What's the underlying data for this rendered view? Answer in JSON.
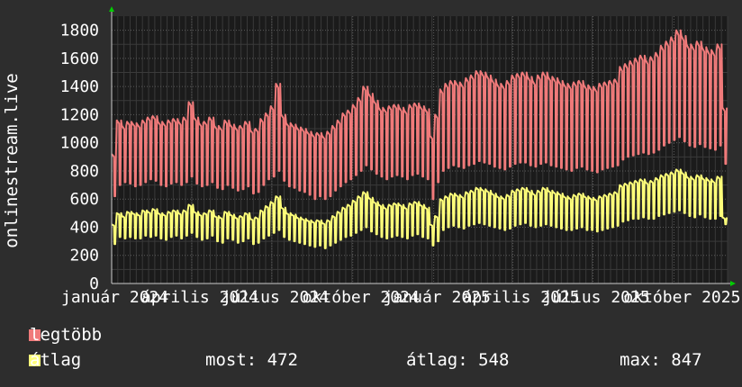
{
  "chart_data": {
    "type": "line",
    "ylabel": "onlinestream.live",
    "ylim": [
      0,
      1900
    ],
    "yticks": [
      0,
      200,
      400,
      600,
      800,
      1000,
      1200,
      1400,
      1600,
      1800
    ],
    "xlim": [
      0,
      700
    ],
    "xticks": [
      {
        "label": "január 2024",
        "x": 0
      },
      {
        "label": "április 2024",
        "x": 91
      },
      {
        "label": "július 2024",
        "x": 182
      },
      {
        "label": "október 2024",
        "x": 274
      },
      {
        "label": "január 2025",
        "x": 366
      },
      {
        "label": "április 2025",
        "x": 456
      },
      {
        "label": "július 2025",
        "x": 547
      },
      {
        "label": "október 2025",
        "x": 639
      }
    ],
    "grid": true,
    "series": [
      {
        "name": "legtöbb",
        "color": "#f07a7a",
        "values": [
          920,
          1160,
          1120,
          1150,
          1140,
          1130,
          1160,
          1180,
          1190,
          1150,
          1140,
          1160,
          1170,
          1150,
          1180,
          1290,
          1180,
          1140,
          1150,
          1180,
          1120,
          1110,
          1160,
          1130,
          1110,
          1120,
          1150,
          1090,
          1100,
          1170,
          1210,
          1260,
          1420,
          1200,
          1140,
          1130,
          1110,
          1100,
          1080,
          1060,
          1070,
          1050,
          1080,
          1120,
          1160,
          1210,
          1230,
          1270,
          1320,
          1400,
          1350,
          1300,
          1250,
          1240,
          1260,
          1270,
          1250,
          1230,
          1270,
          1280,
          1260,
          1240,
          1050,
          1200,
          1380,
          1420,
          1440,
          1430,
          1420,
          1460,
          1480,
          1510,
          1500,
          1480,
          1450,
          1420,
          1410,
          1440,
          1480,
          1490,
          1500,
          1470,
          1440,
          1480,
          1500,
          1470,
          1460,
          1440,
          1420,
          1410,
          1430,
          1440,
          1410,
          1400,
          1390,
          1420,
          1430,
          1440,
          1450,
          1540,
          1560,
          1580,
          1600,
          1620,
          1590,
          1610,
          1640,
          1690,
          1720,
          1750,
          1800,
          1760,
          1700,
          1690,
          1720,
          1680,
          1660,
          1650,
          1700,
          1250
        ],
        "dips": [
          620,
          700,
          720,
          710,
          690,
          700,
          720,
          740,
          730,
          700,
          690,
          710,
          720,
          700,
          720,
          760,
          710,
          690,
          700,
          720,
          680,
          670,
          700,
          680,
          660,
          670,
          690,
          640,
          650,
          700,
          740,
          760,
          800,
          730,
          690,
          680,
          660,
          650,
          630,
          600,
          620,
          600,
          620,
          660,
          690,
          720,
          740,
          770,
          800,
          840,
          810,
          780,
          760,
          740,
          760,
          770,
          760,
          740,
          770,
          780,
          760,
          740,
          600,
          720,
          800,
          820,
          840,
          830,
          820,
          840,
          850,
          870,
          860,
          850,
          830,
          820,
          810,
          830,
          850,
          860,
          860,
          840,
          830,
          850,
          860,
          840,
          830,
          820,
          810,
          800,
          820,
          830,
          810,
          800,
          790,
          810,
          820,
          830,
          840,
          880,
          900,
          910,
          920,
          930,
          920,
          930,
          950,
          980,
          1000,
          1020,
          1040,
          1010,
          980,
          970,
          990,
          970,
          960,
          950,
          980,
          850
        ]
      },
      {
        "name": "átlag",
        "color": "#ffff7a",
        "values": [
          420,
          500,
          480,
          510,
          500,
          490,
          520,
          510,
          530,
          500,
          490,
          510,
          520,
          500,
          520,
          560,
          510,
          490,
          500,
          520,
          480,
          470,
          510,
          490,
          470,
          480,
          500,
          460,
          470,
          520,
          550,
          580,
          620,
          540,
          500,
          490,
          470,
          460,
          450,
          440,
          450,
          430,
          450,
          480,
          510,
          540,
          560,
          590,
          620,
          650,
          610,
          580,
          560,
          540,
          560,
          570,
          560,
          540,
          570,
          580,
          560,
          540,
          420,
          480,
          600,
          620,
          640,
          630,
          620,
          650,
          660,
          680,
          670,
          660,
          640,
          620,
          610,
          630,
          660,
          670,
          680,
          660,
          640,
          660,
          680,
          660,
          650,
          640,
          620,
          610,
          630,
          640,
          620,
          610,
          600,
          620,
          630,
          640,
          650,
          700,
          710,
          720,
          730,
          740,
          720,
          730,
          750,
          770,
          780,
          790,
          810,
          790,
          760,
          750,
          770,
          750,
          740,
          730,
          760,
          470
        ],
        "dips": [
          280,
          330,
          320,
          330,
          320,
          320,
          340,
          330,
          340,
          320,
          310,
          330,
          340,
          320,
          340,
          360,
          330,
          310,
          320,
          340,
          300,
          290,
          320,
          310,
          290,
          300,
          320,
          280,
          290,
          320,
          340,
          360,
          380,
          330,
          310,
          300,
          290,
          280,
          270,
          260,
          270,
          250,
          270,
          290,
          310,
          330,
          340,
          360,
          380,
          400,
          370,
          350,
          330,
          320,
          330,
          340,
          330,
          320,
          340,
          350,
          330,
          320,
          270,
          300,
          380,
          400,
          410,
          400,
          390,
          410,
          420,
          430,
          420,
          410,
          400,
          390,
          380,
          390,
          410,
          420,
          430,
          410,
          400,
          410,
          420,
          410,
          400,
          390,
          380,
          380,
          390,
          400,
          380,
          380,
          370,
          380,
          390,
          400,
          410,
          440,
          450,
          460,
          460,
          470,
          460,
          460,
          480,
          490,
          500,
          510,
          520,
          500,
          480,
          470,
          490,
          470,
          460,
          460,
          480,
          420
        ]
      }
    ]
  },
  "legend": [
    {
      "label": "legtöbb",
      "color": "#f07a7a"
    },
    {
      "label": "átlag",
      "color": "#ffff7a"
    }
  ],
  "stats": {
    "most": "most: 472",
    "atlag": "átlag: 548",
    "max": "max: 847"
  }
}
